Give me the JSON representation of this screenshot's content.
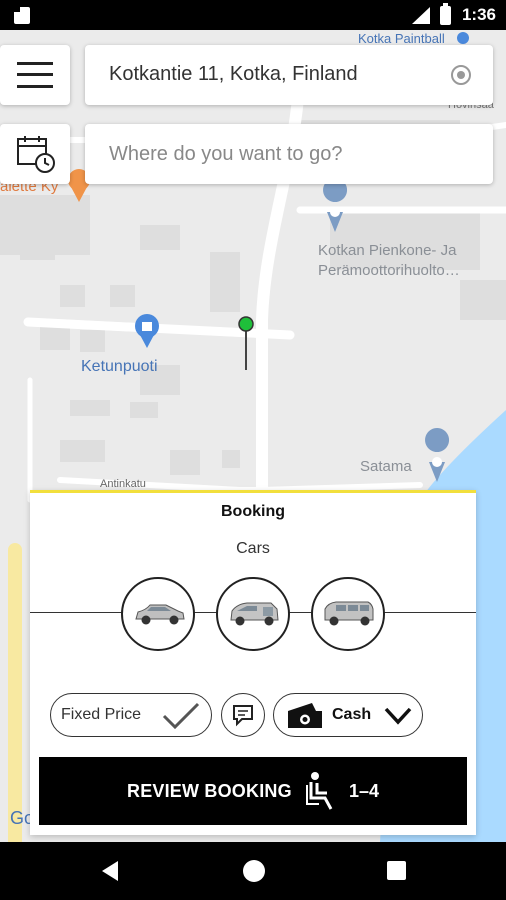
{
  "status_bar": {
    "time": "1:36"
  },
  "map": {
    "labels": {
      "kotka_paintball": "Kotka Paintball",
      "hovinsaari": "Hovinsaa",
      "palette": "alette Ky",
      "pienkone_line1": "Kotkan Pienkone- Ja",
      "pienkone_line2": "Perämoottorihuolto…",
      "ketunpuoti": "Ketunpuoti",
      "satama": "Satama",
      "antinkatu": "Antinkatu",
      "google": "Go"
    }
  },
  "search": {
    "pickup_address": "Kotkantie 11, Kotka, Finland",
    "destination_placeholder": "Where do you want to go?"
  },
  "booking": {
    "title": "Booking",
    "category": "Cars",
    "vehicles": [
      "sedan-car-icon",
      "wheelchair-van-icon",
      "minivan-icon"
    ],
    "fixed_price_label": "Fixed Price",
    "payment_label": "Cash",
    "review_button_label": "REVIEW BOOKING",
    "passenger_count": "1–4"
  }
}
